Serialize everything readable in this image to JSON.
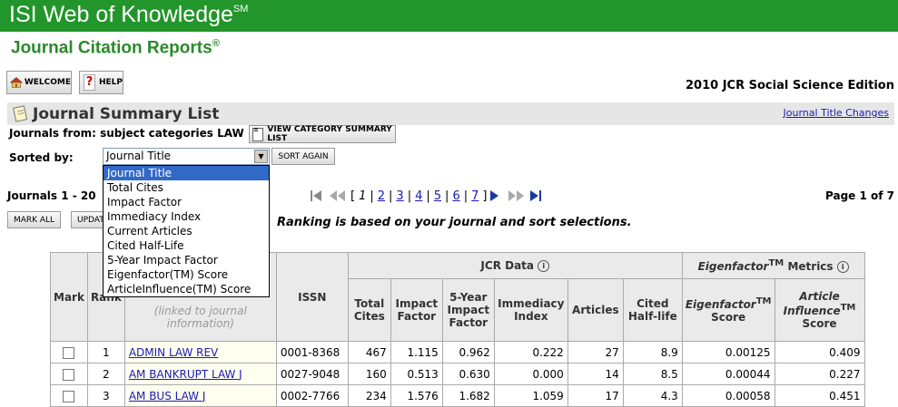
{
  "header": {
    "brand": "ISI Web of Knowledge",
    "brand_mark": "SM",
    "product": "Journal Citation Reports",
    "product_mark": "®"
  },
  "toolbar": {
    "welcome_label": "WELCOME",
    "help_label": "HELP"
  },
  "edition": "2010 JCR Social Science Edition",
  "summary": {
    "title": "Journal Summary List",
    "title_changes_link": "Journal Title Changes"
  },
  "journals_from": {
    "label": "Journals from:",
    "value": "subject categories LAW",
    "view_button": "VIEW CATEGORY SUMMARY LIST"
  },
  "sort": {
    "label": "Sorted by:",
    "selected": "Journal Title",
    "sort_again_label": "SORT AGAIN",
    "options": [
      "Journal Title",
      "Total Cites",
      "Impact Factor",
      "Immediacy Index",
      "Current Articles",
      "Cited Half-Life",
      "5-Year Impact Factor",
      "Eigenfactor(TM) Score",
      "ArticleInfluence(TM) Score"
    ]
  },
  "range": {
    "label": "Journals 1 - 20",
    "page_info": "Page 1 of 7"
  },
  "pager": {
    "current": "1",
    "pages": [
      "2",
      "3",
      "4",
      "5",
      "6",
      "7"
    ]
  },
  "actions": {
    "mark_all": "MARK ALL",
    "update": "UPDATE"
  },
  "ranking_note": "Ranking is based on your journal and sort selections.",
  "table": {
    "col_mark": "Mark",
    "col_rank": "Rank",
    "col_title_hint": "(linked to journal information)",
    "col_issn": "ISSN",
    "jcr_group": "JCR Data",
    "eigen_group": "Eigenfactor",
    "eigen_group_tm": "TM",
    "eigen_group_tail": "Metrics",
    "col_total_cites": "Total Cites",
    "col_impact": "Impact Factor",
    "col_5yr": "5-Year Impact Factor",
    "col_immediacy": "Immediacy Index",
    "col_articles": "Articles",
    "col_halflife": "Cited Half-life",
    "col_eigen_name": "Eigenfactor",
    "col_eigen_tm": "TM",
    "col_eigen_score": "Score",
    "col_ai_name": "Article Influence",
    "col_ai_tm": "TM",
    "col_ai_score": "Score",
    "rows": [
      {
        "rank": "1",
        "title": "ADMIN LAW REV",
        "issn": "0001-8368",
        "total_cites": "467",
        "impact": "1.115",
        "five_year": "0.962",
        "immediacy": "0.222",
        "articles": "27",
        "halflife": "8.9",
        "eigen": "0.00125",
        "ai": "0.409"
      },
      {
        "rank": "2",
        "title": "AM BANKRUPT LAW J",
        "issn": "0027-9048",
        "total_cites": "160",
        "impact": "0.513",
        "five_year": "0.630",
        "immediacy": "0.000",
        "articles": "14",
        "halflife": "8.5",
        "eigen": "0.00044",
        "ai": "0.227"
      },
      {
        "rank": "3",
        "title": "AM BUS LAW J",
        "issn": "0002-7766",
        "total_cites": "234",
        "impact": "1.576",
        "five_year": "1.682",
        "immediacy": "1.059",
        "articles": "17",
        "halflife": "4.3",
        "eigen": "0.00058",
        "ai": "0.451"
      }
    ]
  }
}
